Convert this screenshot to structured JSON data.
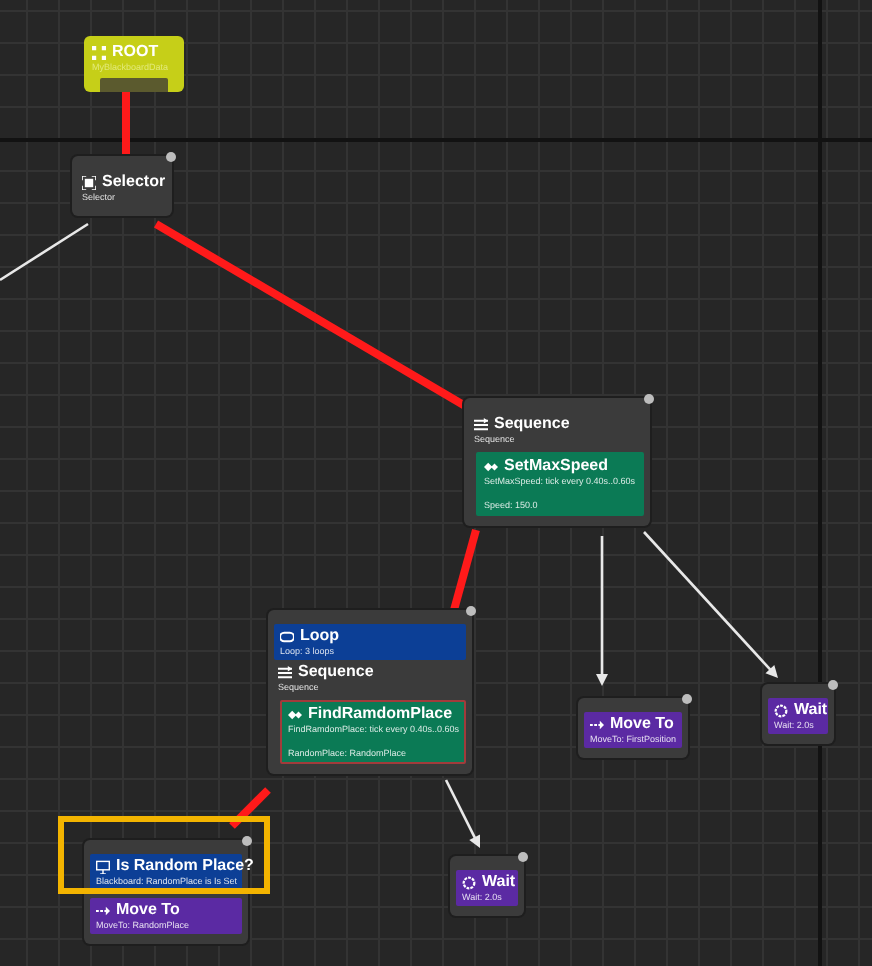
{
  "nodes": [
    {
      "kind": "root",
      "title": "ROOT",
      "subtitle": "MyBlackboardData"
    },
    {
      "kind": "composite",
      "title": "Selector",
      "subtitle": "Selector"
    },
    {
      "kind": "composite",
      "title": "Sequence",
      "subtitle": "Sequence",
      "services": [
        {
          "title": "SetMaxSpeed",
          "lines": [
            "SetMaxSpeed: tick every 0.40s..0.60s",
            "Speed: 150.0"
          ],
          "highlighted": false
        }
      ]
    },
    {
      "kind": "composite",
      "title": "Sequence",
      "subtitle": "Sequence",
      "decorators": [
        {
          "kind": "loop",
          "title": "Loop",
          "detail": "Loop: 3 loops"
        }
      ],
      "services": [
        {
          "title": "FindRamdomPlace",
          "lines": [
            "FindRamdomPlace: tick every 0.40s..0.60s",
            "RandomPlace: RandomPlace"
          ],
          "highlighted": true
        }
      ]
    },
    {
      "kind": "task",
      "title": "Move To",
      "detail": "MoveTo: FirstPosition"
    },
    {
      "kind": "task",
      "title": "Wait",
      "detail": "Wait: 2.0s"
    },
    {
      "kind": "task",
      "title": "Move To",
      "detail": "MoveTo: RandomPlace",
      "decorators": [
        {
          "kind": "blackboard",
          "title": "Is Random Place?",
          "detail": "Blackboard: RandomPlace is Is Set"
        }
      ],
      "highlighted": true
    },
    {
      "kind": "task",
      "title": "Wait",
      "detail": "Wait: 2.0s"
    }
  ],
  "links": [
    {
      "active": true
    },
    {
      "active": true
    },
    {
      "active": true
    },
    {
      "active": true
    },
    {
      "active": false
    },
    {
      "active": false
    },
    {
      "active": false
    },
    {
      "active": false
    }
  ]
}
